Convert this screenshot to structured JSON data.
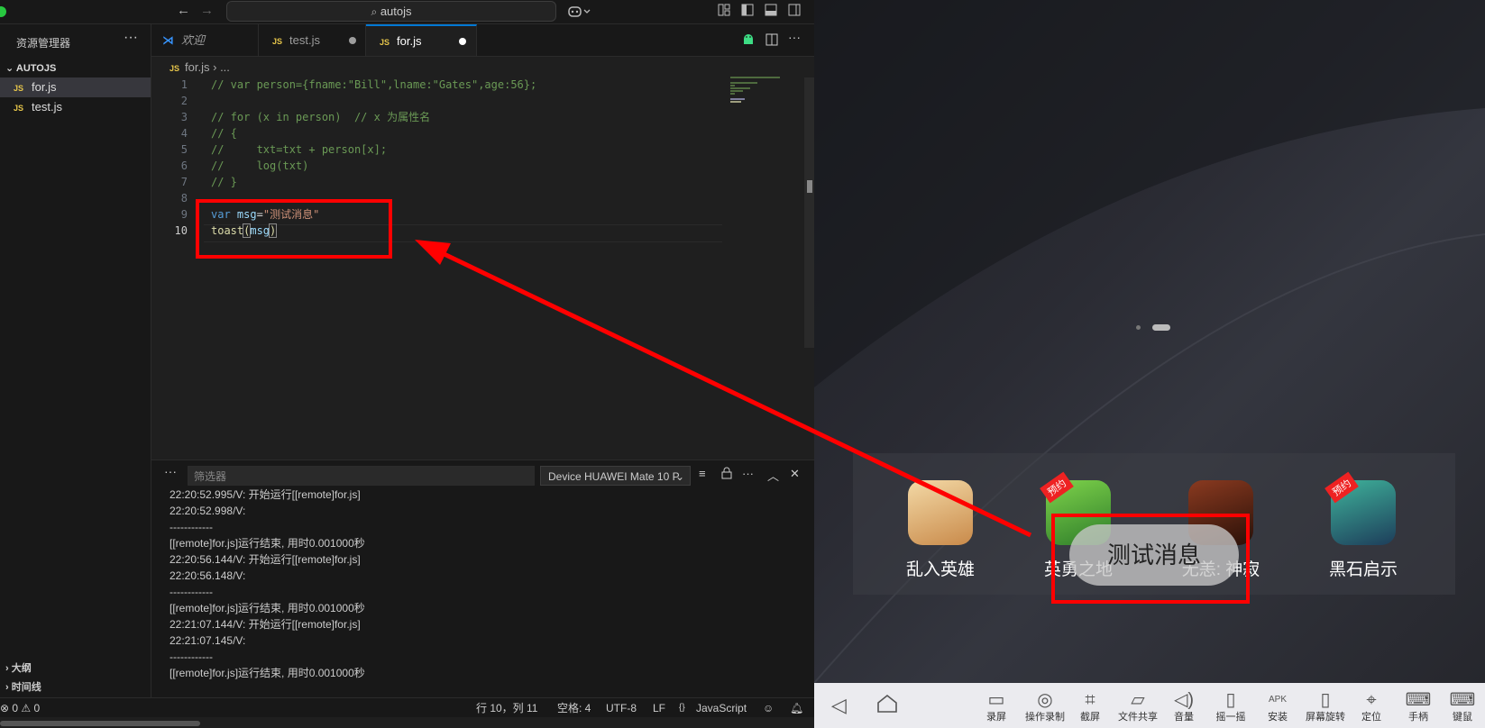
{
  "titlebar": {
    "search": "autojs",
    "back": "←",
    "forward": "→"
  },
  "sidebar": {
    "title": "资源管理器",
    "more": "···",
    "project": "AUTOJS",
    "files": [
      {
        "label": "for.js"
      },
      {
        "label": "test.js"
      }
    ],
    "outline": "大纲",
    "timeline": "时间线"
  },
  "tabs": [
    {
      "label": "欢迎"
    },
    {
      "label": "test.js"
    },
    {
      "label": "for.js"
    }
  ],
  "breadcrumb": {
    "file": "for.js",
    "rest": "..."
  },
  "line_numbers": [
    "1",
    "2",
    "3",
    "4",
    "5",
    "6",
    "7",
    "8",
    "9",
    "10"
  ],
  "code": {
    "l1": "// var person={fname:\"Bill\",lname:\"Gates\",age:56};",
    "l3": "// for (x in person)  // x 为属性名",
    "l4": "// {",
    "l5": "//     txt=txt + person[x];",
    "l6": "//     log(txt)",
    "l7": "// }",
    "l9_kw": "var",
    "l9_var": "msg",
    "l9_eq": "=",
    "l9_str": "\"测试消息\"",
    "l10_fn": "toast",
    "l10_open": "(",
    "l10_arg": "msg",
    "l10_close": ")"
  },
  "panel": {
    "more": "···",
    "filter_placeholder": "筛选器",
    "device": "Device HUAWEI Mate 10 P",
    "logs": [
      "22:20:52.995/V: 开始运行[[remote]for.js]",
      "22:20:52.998/V:",
      "------------",
      "[[remote]for.js]运行结束, 用时0.001000秒",
      "22:20:56.144/V: 开始运行[[remote]for.js]",
      "22:20:56.148/V:",
      "------------",
      "[[remote]for.js]运行结束, 用时0.001000秒",
      "22:21:07.144/V: 开始运行[[remote]for.js]",
      "22:21:07.145/V:",
      "------------",
      "[[remote]for.js]运行结束, 用时0.001000秒"
    ]
  },
  "statusbar": {
    "problems": "⊗ 0 ⚠ 0",
    "position": "行 10，列 11",
    "spaces": "空格: 4",
    "encoding": "UTF-8",
    "eol": "LF",
    "braces": "{}",
    "language": "JavaScript"
  },
  "phone": {
    "apps": [
      {
        "label": "乱入英雄",
        "color": "#e8c58a"
      },
      {
        "label": "英勇之地",
        "color": "#6fbf3a"
      },
      {
        "label": "无恙: 神寂",
        "color": "#5a2a1e"
      },
      {
        "label": "黑石启示",
        "color": "#2f8f7a"
      }
    ],
    "badge": "预约",
    "toast": "测试消息",
    "toolbar": [
      {
        "label": "录屏",
        "icon": "video-icon"
      },
      {
        "label": "操作录制",
        "icon": "record-icon"
      },
      {
        "label": "截屏",
        "icon": "crop-icon"
      },
      {
        "label": "文件共享",
        "icon": "folder-icon"
      },
      {
        "label": "音量",
        "icon": "volume-icon"
      },
      {
        "label": "摇一摇",
        "icon": "shake-icon"
      },
      {
        "label": "安装",
        "icon": "apk-icon"
      },
      {
        "label": "屏幕旋转",
        "icon": "rotate-icon"
      },
      {
        "label": "定位",
        "icon": "location-icon"
      },
      {
        "label": "手柄",
        "icon": "gamepad-icon"
      },
      {
        "label": "键鼠",
        "icon": "keyboard-icon"
      }
    ],
    "apk_text": "APK"
  },
  "colors": {
    "annotation": "#ff0000",
    "accent": "#0078d4"
  }
}
